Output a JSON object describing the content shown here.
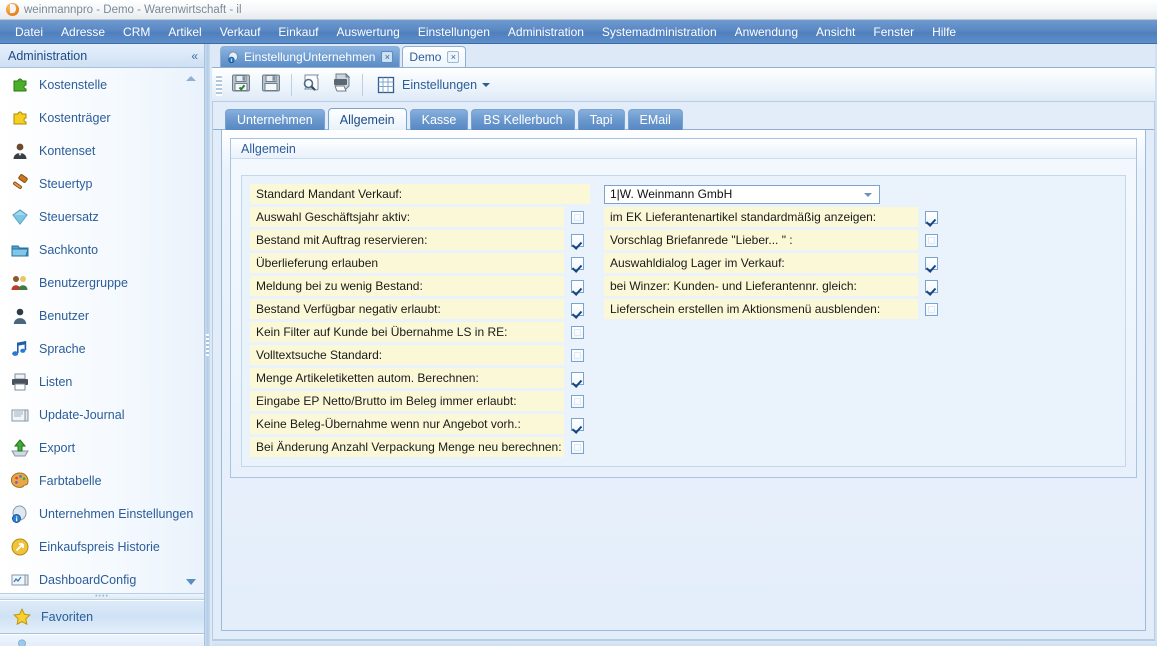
{
  "window": {
    "title": "weinmannpro - Demo - Warenwirtschaft - il",
    "logo_icon": "app-logo-icon"
  },
  "menubar": {
    "items": [
      {
        "label": "Datei"
      },
      {
        "label": "Adresse"
      },
      {
        "label": "CRM"
      },
      {
        "label": "Artikel"
      },
      {
        "label": "Verkauf"
      },
      {
        "label": "Einkauf"
      },
      {
        "label": "Auswertung"
      },
      {
        "label": "Einstellungen"
      },
      {
        "label": "Administration"
      },
      {
        "label": "Systemadministration"
      },
      {
        "label": "Anwendung"
      },
      {
        "label": "Ansicht"
      },
      {
        "label": "Fenster"
      },
      {
        "label": "Hilfe"
      }
    ]
  },
  "sidebar": {
    "title": "Administration",
    "collapse_glyph": "«",
    "items": [
      {
        "label": "Kostenstelle",
        "icon": "puzzle-green-icon"
      },
      {
        "label": "Kostenträger",
        "icon": "puzzle-yellow-icon"
      },
      {
        "label": "Kontenset",
        "icon": "person-dark-icon"
      },
      {
        "label": "Steuertyp",
        "icon": "gavel-icon"
      },
      {
        "label": "Steuersatz",
        "icon": "diamond-icon"
      },
      {
        "label": "Sachkonto",
        "icon": "folder-blue-icon"
      },
      {
        "label": "Benutzergruppe",
        "icon": "users-group-icon"
      },
      {
        "label": "Benutzer",
        "icon": "user-icon"
      },
      {
        "label": "Sprache",
        "icon": "music-note-icon"
      },
      {
        "label": "Listen",
        "icon": "printer-icon"
      },
      {
        "label": "Update-Journal",
        "icon": "journal-icon"
      },
      {
        "label": "Export",
        "icon": "export-up-arrow-icon"
      },
      {
        "label": "Farbtabelle",
        "icon": "palette-icon"
      },
      {
        "label": "Unternehmen Einstellungen",
        "icon": "company-info-icon"
      },
      {
        "label": "Einkaufspreis Historie",
        "icon": "history-arrow-icon"
      },
      {
        "label": "DashboardConfig",
        "icon": "dashboard-icon"
      }
    ],
    "footer_item": {
      "label": "Favoriten",
      "icon": "star-icon"
    },
    "scroll_up_icon": "scroll-up-arrow-icon",
    "scroll_down_icon": "scroll-down-arrow-icon"
  },
  "mdi_tabs": [
    {
      "label": "EinstellungUnternehmen",
      "active": true,
      "icon": "settings-company-icon",
      "close_glyph": "×"
    },
    {
      "label": "Demo",
      "active": false,
      "icon": "",
      "close_glyph": "×"
    }
  ],
  "toolbar": {
    "buttons": [
      {
        "name": "save-and-close-button",
        "icon": "save-check-icon"
      },
      {
        "name": "save-button",
        "icon": "save-icon"
      },
      {
        "name": "preview-button",
        "icon": "preview-magnifier-icon"
      },
      {
        "name": "print-button",
        "icon": "printer-icon"
      }
    ],
    "menu": {
      "label": "Einstellungen",
      "icon": "grid-table-icon",
      "caret": "caret-down-icon"
    }
  },
  "form_tabs": [
    {
      "label": "Unternehmen",
      "active": false
    },
    {
      "label": "Allgemein",
      "active": true
    },
    {
      "label": "Kasse",
      "active": false
    },
    {
      "label": "BS Kellerbuch",
      "active": false
    },
    {
      "label": "Tapi",
      "active": false
    },
    {
      "label": "EMail",
      "active": false
    }
  ],
  "groupbox": {
    "title": "Allgemein",
    "combo": {
      "label": "Standard Mandant Verkauf:",
      "value": "1|W. Weinmann GmbH"
    },
    "left_fields": [
      {
        "label": "Auswahl Geschäftsjahr aktiv:",
        "checked": false
      },
      {
        "label": "Bestand mit Auftrag reservieren:",
        "checked": true
      },
      {
        "label": "Überlieferung erlauben",
        "checked": true
      },
      {
        "label": "Meldung bei zu wenig Bestand:",
        "checked": true
      },
      {
        "label": "Bestand Verfügbar negativ erlaubt:",
        "checked": true
      },
      {
        "label": "Kein Filter auf Kunde bei Übernahme LS in RE:",
        "checked": false
      },
      {
        "label": "Volltextsuche Standard:",
        "checked": false
      },
      {
        "label": "Menge Artikeletiketten autom. Berechnen:",
        "checked": true
      },
      {
        "label": "Eingabe EP Netto/Brutto im Beleg immer erlaubt:",
        "checked": false
      },
      {
        "label": "Keine Beleg-Übernahme wenn nur Angebot vorh.:",
        "checked": true
      },
      {
        "label": "Bei Änderung Anzahl Verpackung Menge neu berechnen:",
        "checked": false
      }
    ],
    "right_fields": [
      {
        "label": "im EK Lieferantenartikel standardmäßig anzeigen:",
        "checked": true
      },
      {
        "label": "Vorschlag Briefanrede \"Lieber... \" :",
        "checked": false
      },
      {
        "label": "Auswahldialog Lager im Verkauf:",
        "checked": true
      },
      {
        "label": "bei Winzer: Kunden- und Lieferantennr. gleich:",
        "checked": true
      },
      {
        "label": "Lieferschein erstellen im Aktionsmenü ausblenden:",
        "checked": false
      }
    ]
  },
  "colors": {
    "menu_blue": "#5a88c4",
    "field_yellow": "#fbf8d8",
    "link_blue": "#2b5d99",
    "panel_blue": "#e3edfa"
  }
}
